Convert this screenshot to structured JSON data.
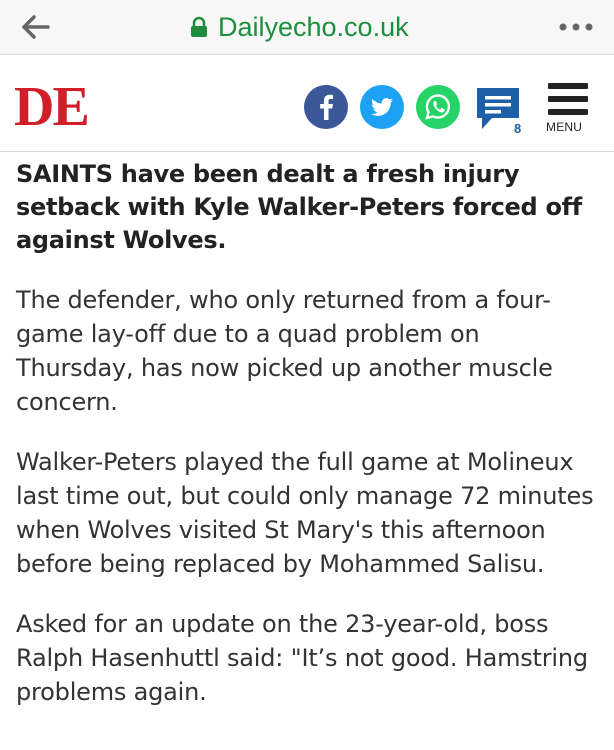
{
  "browser": {
    "url_host": "Dailyecho.co.uk",
    "icons": {
      "back": "back-arrow-icon",
      "lock": "lock-icon",
      "more": "more-options-icon"
    }
  },
  "header": {
    "logo_text": "DE",
    "share": [
      {
        "name": "facebook",
        "icon": "facebook-icon",
        "color": "#3b5998"
      },
      {
        "name": "twitter",
        "icon": "twitter-icon",
        "color": "#1da1f2"
      },
      {
        "name": "whatsapp",
        "icon": "whatsapp-icon",
        "color": "#25d366"
      }
    ],
    "comments": {
      "icon": "comments-icon",
      "count": "8",
      "color": "#1d5fa8"
    },
    "menu_label": "MENU"
  },
  "colors": {
    "brand_red": "#d11f2a",
    "url_green": "#1e8e3e"
  },
  "article": {
    "lede": "SAINTS have been dealt a fresh injury setback with Kyle Walker-Peters forced off against Wolves.",
    "paragraphs": [
      "The defender, who only returned from a four-game lay-off due to a quad problem on Thursday, has now picked up another muscle concern.",
      "Walker-Peters played the full game at Molineux last time out, but could only manage 72 minutes when Wolves visited St Mary's this afternoon before being replaced by Mohammed Salisu.",
      "Asked for an update on the 23-year-old, boss Ralph Hasenhuttl said: \"It’s not good. Hamstring problems again."
    ]
  }
}
